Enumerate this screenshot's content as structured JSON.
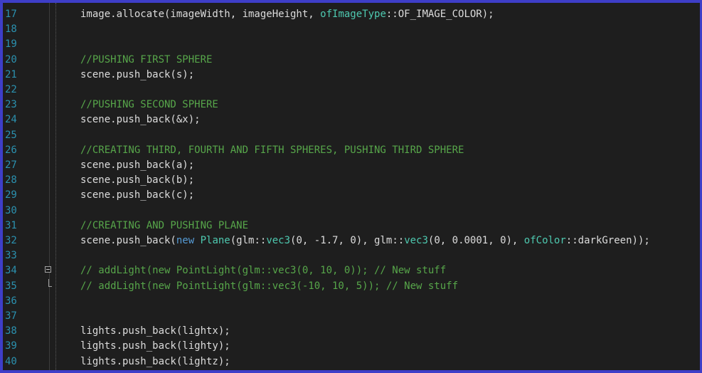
{
  "editor": {
    "lines": [
      {
        "num": "17",
        "tokens": [
          [
            "plain",
            "image.allocate(imageWidth, imageHeight, "
          ],
          [
            "type",
            "ofImageType"
          ],
          [
            "plain",
            "::OF_IMAGE_COLOR);"
          ]
        ]
      },
      {
        "num": "18",
        "tokens": []
      },
      {
        "num": "19",
        "tokens": []
      },
      {
        "num": "20",
        "tokens": [
          [
            "comment",
            "//PUSHING FIRST SPHERE"
          ]
        ]
      },
      {
        "num": "21",
        "tokens": [
          [
            "plain",
            "scene.push_back(s);"
          ]
        ]
      },
      {
        "num": "22",
        "tokens": []
      },
      {
        "num": "23",
        "tokens": [
          [
            "comment",
            "//PUSHING SECOND SPHERE"
          ]
        ]
      },
      {
        "num": "24",
        "tokens": [
          [
            "plain",
            "scene.push_back(&x);"
          ]
        ]
      },
      {
        "num": "25",
        "tokens": []
      },
      {
        "num": "26",
        "tokens": [
          [
            "comment",
            "//CREATING THIRD, FOURTH AND FIFTH SPHERES, PUSHING THIRD SPHERE"
          ]
        ]
      },
      {
        "num": "27",
        "tokens": [
          [
            "plain",
            "scene.push_back(a);"
          ]
        ]
      },
      {
        "num": "28",
        "tokens": [
          [
            "plain",
            "scene.push_back(b);"
          ]
        ]
      },
      {
        "num": "29",
        "tokens": [
          [
            "plain",
            "scene.push_back(c);"
          ]
        ]
      },
      {
        "num": "30",
        "tokens": []
      },
      {
        "num": "31",
        "tokens": [
          [
            "comment",
            "//CREATING AND PUSHING PLANE"
          ]
        ]
      },
      {
        "num": "32",
        "tokens": [
          [
            "plain",
            "scene.push_back("
          ],
          [
            "kw",
            "new"
          ],
          [
            "plain",
            " "
          ],
          [
            "type",
            "Plane"
          ],
          [
            "plain",
            "(glm::"
          ],
          [
            "type",
            "vec3"
          ],
          [
            "plain",
            "(0, -1.7, 0), glm::"
          ],
          [
            "type",
            "vec3"
          ],
          [
            "plain",
            "(0, 0.0001, 0), "
          ],
          [
            "type",
            "ofColor"
          ],
          [
            "plain",
            "::darkGreen));"
          ]
        ]
      },
      {
        "num": "33",
        "tokens": []
      },
      {
        "num": "34",
        "fold": "start",
        "tokens": [
          [
            "comment",
            "// addLight(new PointLight(glm::vec3(0, 10, 0)); // New stuff"
          ]
        ]
      },
      {
        "num": "35",
        "fold": "end",
        "tokens": [
          [
            "comment",
            "// addLight(new PointLight(glm::vec3(-10, 10, 5)); // New stuff"
          ]
        ]
      },
      {
        "num": "36",
        "tokens": []
      },
      {
        "num": "37",
        "tokens": []
      },
      {
        "num": "38",
        "tokens": [
          [
            "plain",
            "lights.push_back(lightx);"
          ]
        ]
      },
      {
        "num": "39",
        "tokens": [
          [
            "plain",
            "lights.push_back(lighty);"
          ]
        ]
      },
      {
        "num": "40",
        "tokens": [
          [
            "plain",
            "lights.push_back(lightz);"
          ]
        ]
      }
    ]
  },
  "colors": {
    "border": "#3e3ec8",
    "background": "#1e1e1e",
    "line_number": "#2b91af",
    "comment": "#57a64a",
    "type": "#4ec9b0",
    "keyword": "#569cd6",
    "text": "#dcdcdc"
  }
}
